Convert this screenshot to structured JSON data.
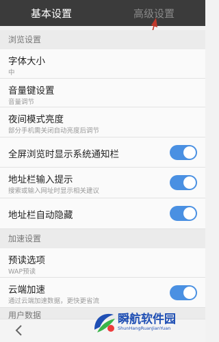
{
  "tabs": {
    "basic": "基本设置",
    "advanced": "高级设置"
  },
  "sections": {
    "browse": "浏览设置",
    "speed": "加速设置",
    "user_data": "用户数据"
  },
  "items": {
    "font_size": {
      "title": "字体大小",
      "sub": "中"
    },
    "volume_key": {
      "title": "音量键设置",
      "sub": "音量调节"
    },
    "night_brightness": {
      "title": "夜间模式亮度",
      "sub": "部分手机需关闭自动亮度后调节"
    },
    "fullscreen_notify": {
      "title": "全屏浏览时显示系统通知栏",
      "toggle": "on"
    },
    "address_hint": {
      "title": "地址栏输入提示",
      "sub": "搜索或输入网址时显示相关建议",
      "toggle": "on"
    },
    "address_autohide": {
      "title": "地址栏自动隐藏",
      "toggle": "on"
    },
    "preload": {
      "title": "预读选项",
      "sub": "WAP预读"
    },
    "cloud_speed": {
      "title": "云端加速",
      "sub": "通过云端加速数据，更快更省流",
      "toggle": "on"
    }
  },
  "watermark": {
    "title": "瞬航软件园",
    "subtitle": "ShunHangRuanJianYuan"
  },
  "colors": {
    "accent": "#4a90e2",
    "tab_bar": "#3b3b3b",
    "arrow": "#c0392b"
  },
  "icons": {
    "back": "chevron-left-icon"
  }
}
